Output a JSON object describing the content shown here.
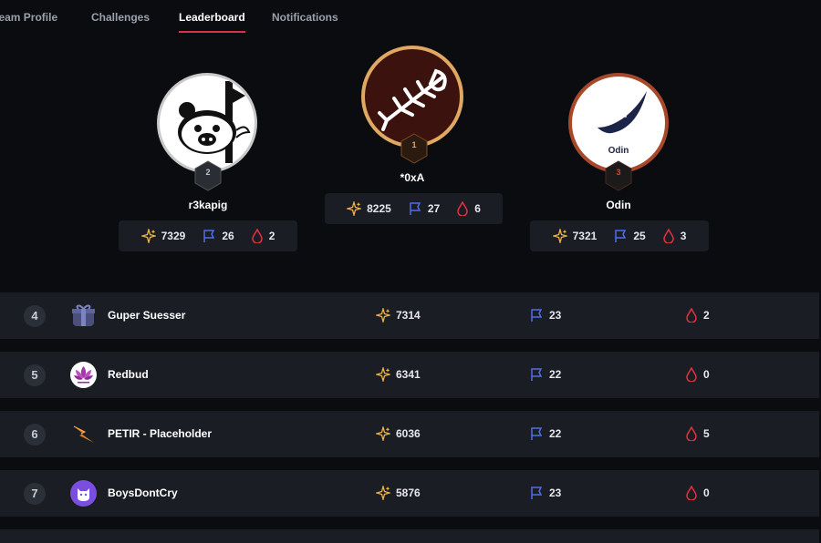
{
  "nav": {
    "tabs": [
      {
        "label": "Team Profile"
      },
      {
        "label": "Challenges"
      },
      {
        "label": "Leaderboard"
      },
      {
        "label": "Notifications"
      }
    ],
    "active": "Leaderboard"
  },
  "podium": [
    {
      "rank": "2",
      "name": "r3kapig",
      "points": "7329",
      "flags": "26",
      "bloods": "2",
      "avatar_icon": "pig-icon"
    },
    {
      "rank": "1",
      "name": "*0xA",
      "points": "8225",
      "flags": "27",
      "bloods": "6",
      "avatar_icon": "fishbone-icon"
    },
    {
      "rank": "3",
      "name": "Odin",
      "points": "7321",
      "flags": "25",
      "bloods": "3",
      "avatar_icon": "feather-icon",
      "avatar_text": "Odin"
    }
  ],
  "rows": [
    {
      "rank": "4",
      "name": "Guper Suesser",
      "points": "7314",
      "flags": "23",
      "bloods": "2",
      "avatar_icon": "gift-icon"
    },
    {
      "rank": "5",
      "name": "Redbud",
      "points": "6341",
      "flags": "22",
      "bloods": "0",
      "avatar_icon": "lotus-icon"
    },
    {
      "rank": "6",
      "name": "PETIR - Placeholder",
      "points": "6036",
      "flags": "22",
      "bloods": "5",
      "avatar_icon": "lightning-icon"
    },
    {
      "rank": "7",
      "name": "BoysDontCry",
      "points": "5876",
      "flags": "23",
      "bloods": "0",
      "avatar_icon": "cat-icon"
    }
  ],
  "colors": {
    "background": "#0b0c10",
    "row_background": "#1a1d23",
    "accent_underline": "#d6334a",
    "points_icon": "#f0b448",
    "flag_icon": "#4d6fe8",
    "blood_icon": "#e0313f",
    "gold_ring": "#e0a860",
    "bronze_ring": "#a8482a"
  }
}
